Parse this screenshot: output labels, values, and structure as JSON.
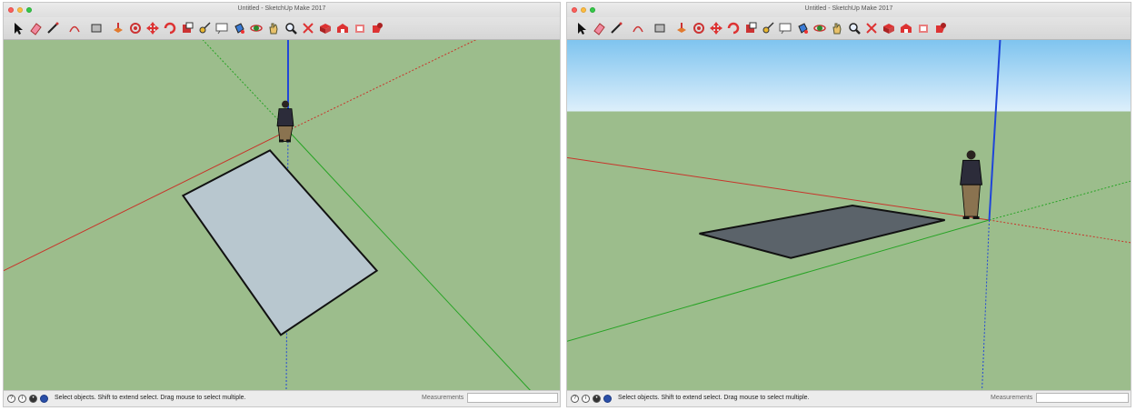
{
  "windows": [
    {
      "title": "Untitled - SketchUp Make 2017",
      "status_text": "Select objects. Shift to extend select. Drag mouse to select multiple.",
      "measurements_label": "Measurements",
      "measurements_value": ""
    },
    {
      "title": "Untitled - SketchUp Make 2017",
      "status_text": "Select objects. Shift to extend select. Drag mouse to select multiple.",
      "measurements_label": "Measurements",
      "measurements_value": ""
    }
  ],
  "toolbar_tools": [
    "select",
    "eraser",
    "line",
    "arc",
    "shape",
    "push-pull",
    "offset",
    "move",
    "rotate",
    "scale",
    "tape-measure",
    "text",
    "paint-bucket",
    "orbit",
    "pan",
    "zoom",
    "zoom-extents",
    "components",
    "warehouse",
    "extension-warehouse",
    "layout"
  ],
  "status_icons": [
    "help-icon",
    "info-icon",
    "user-icon",
    "geo-icon"
  ],
  "colors": {
    "ground": "#9cbd8c",
    "sky_top": "#7fc4ef",
    "sky_bottom": "#ddeffb",
    "axis_red": "#c8342a",
    "axis_green": "#26a324",
    "axis_blue": "#1f45d8",
    "face_front": "#b8c7cf",
    "face_back": "#5b636a"
  }
}
